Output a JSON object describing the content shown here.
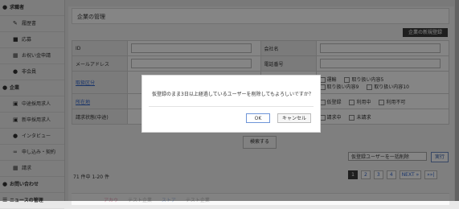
{
  "sidebar": {
    "items": [
      {
        "label": "求職者",
        "icon": "user-icon",
        "type": "head"
      },
      {
        "label": "履歴書",
        "icon": "pencil-icon",
        "type": "sub"
      },
      {
        "label": "応募",
        "icon": "folder-icon",
        "type": "sub"
      },
      {
        "label": "お祝い金申請",
        "icon": "document-icon",
        "type": "sub"
      },
      {
        "label": "非会員",
        "icon": "user-icon",
        "type": "sub"
      },
      {
        "label": "企業",
        "icon": "users-icon",
        "type": "head"
      },
      {
        "label": "中途採用求人",
        "icon": "copy-icon",
        "type": "sub"
      },
      {
        "label": "新卒採用求人",
        "icon": "copy-icon",
        "type": "sub"
      },
      {
        "label": "インタビュー",
        "icon": "users-icon",
        "type": "sub"
      },
      {
        "label": "申し込み・契約",
        "icon": "link-icon",
        "type": "sub"
      },
      {
        "label": "請求",
        "icon": "document-icon",
        "type": "sub"
      },
      {
        "label": "お問い合わせ",
        "icon": "info-icon",
        "type": "head"
      },
      {
        "label": "ニュースの管理",
        "icon": "list-icon",
        "type": "head"
      }
    ]
  },
  "main": {
    "title": "企業の管理",
    "new_button": "企業の新規登録",
    "form": {
      "id_label": "ID",
      "company_name_label": "会社名",
      "email_label": "メールアドレス",
      "phone_label": "電話番号",
      "handling_label": "取扱区分",
      "handling_options_right": [
        "運輸",
        "取り扱い内容5",
        "取り扱い内容9",
        "取り扱い内容10"
      ],
      "location_label": "所在地",
      "location_options_right": [
        "仮登録",
        "利用中",
        "利用不可"
      ],
      "invoice_label": "請求状態(中途)",
      "invoice_options_right": [
        "請求中",
        "未請求"
      ],
      "search_button": "検索する"
    },
    "bulk_select_value": "仮登録ユーザーを一括削除",
    "run_button": "実行",
    "count_text": "71 件中 1-20 件",
    "pagination": [
      "1",
      "2",
      "3",
      "4",
      "NEXT »",
      "»»|"
    ],
    "list_preview": [
      "アカウ",
      "テスト企業",
      "ストア",
      "テスト企業"
    ]
  },
  "dialog": {
    "message": "仮登録のまま3日以上経過しているユーザーを削除してもよろしいですか？",
    "ok_label": "OK",
    "cancel_label": "キャンセル"
  },
  "colors": {
    "overlay": "#000000",
    "accent_dark": "#3c3c3c",
    "link": "#3366cc"
  }
}
